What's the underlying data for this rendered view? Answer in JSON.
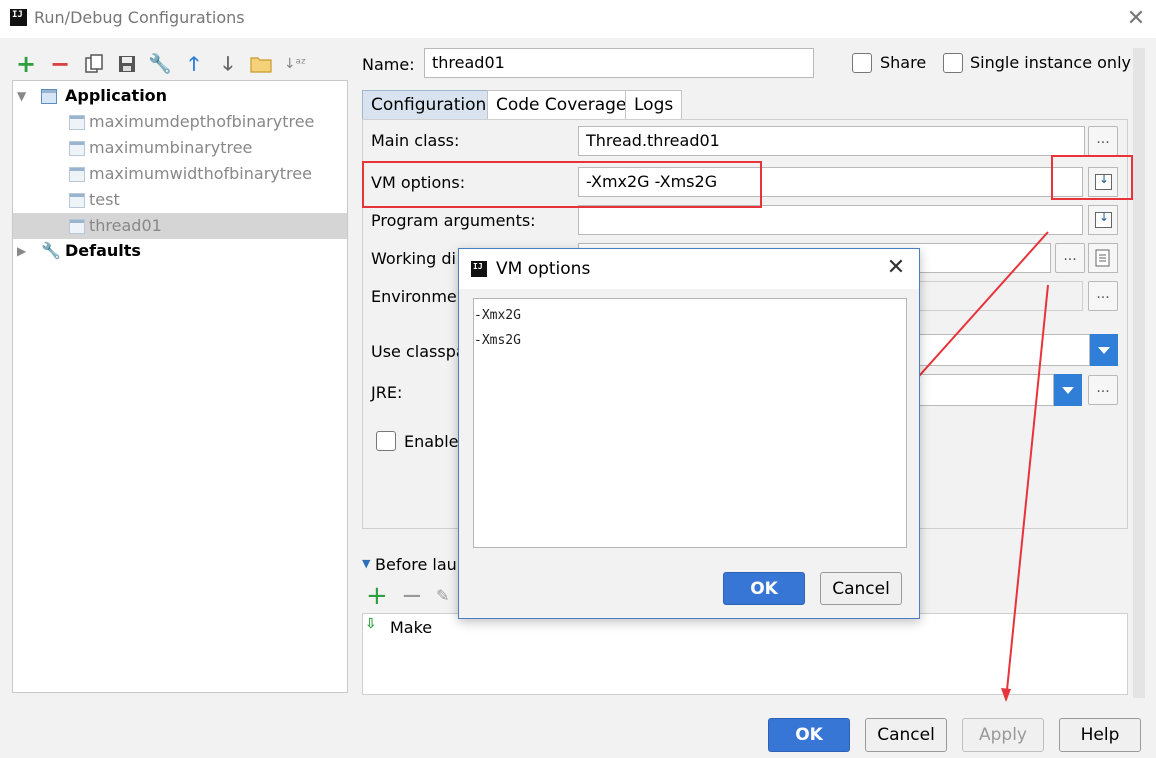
{
  "window": {
    "title": "Run/Debug Configurations",
    "logo": "IJ"
  },
  "toolbar": {
    "icons": [
      "add-icon",
      "remove-icon",
      "copy-icon",
      "save-icon",
      "wrench-icon",
      "move-up-icon",
      "move-down-icon",
      "folder-icon",
      "sort-icon"
    ]
  },
  "tree": {
    "application_label": "Application",
    "items": [
      {
        "label": "maximumdepthofbinarytree"
      },
      {
        "label": "maximumbinarytree"
      },
      {
        "label": "maximumwidthofbinarytree"
      },
      {
        "label": "test"
      },
      {
        "label": "thread01"
      }
    ],
    "defaults_label": "Defaults"
  },
  "config": {
    "name_label": "Name:",
    "name_value": "thread01",
    "share_label": "Share",
    "single_instance_label": "Single instance only",
    "tabs": [
      {
        "label": "Configuration"
      },
      {
        "label": "Code Coverage"
      },
      {
        "label": "Logs"
      }
    ],
    "main_class_label": "Main class:",
    "main_class_value": "Thread.thread01",
    "vm_options_label": "VM options:",
    "vm_options_value": "-Xmx2G -Xms2G",
    "program_args_label": "Program arguments:",
    "working_dir_label": "Working di",
    "environment_label": "Environmen",
    "use_classpath_label": "Use classpa",
    "jre_label": "JRE:",
    "enable_label": "Enable",
    "before_launch_label": "Before laun",
    "make_label": "Make",
    "dots": "..."
  },
  "buttons": {
    "ok": "OK",
    "cancel": "Cancel",
    "apply": "Apply",
    "help": "Help"
  },
  "dialog": {
    "title": "VM options",
    "lines": [
      "-Xmx2G",
      "-Xms2G"
    ],
    "ok": "OK",
    "cancel": "Cancel"
  },
  "colors": {
    "accent": "#3876d5",
    "highlight_red": "#e8333a",
    "combo_blue": "#2f7ed8"
  }
}
